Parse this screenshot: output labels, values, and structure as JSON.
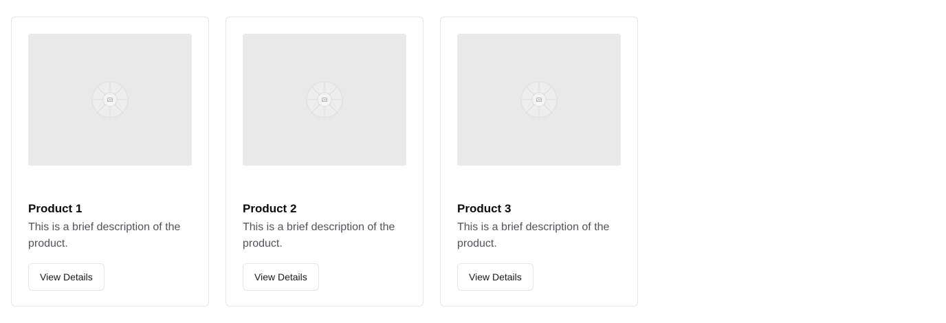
{
  "products": [
    {
      "title": "Product 1",
      "description": "This is a brief description of the product.",
      "button_label": "View Details",
      "image_icon": "image-placeholder-icon"
    },
    {
      "title": "Product 2",
      "description": "This is a brief description of the product.",
      "button_label": "View Details",
      "image_icon": "image-placeholder-icon"
    },
    {
      "title": "Product 3",
      "description": "This is a brief description of the product.",
      "button_label": "View Details",
      "image_icon": "image-placeholder-icon"
    }
  ],
  "colors": {
    "image_background": "#e9e9e9",
    "card_border": "#e4e4e7",
    "title_text": "#0a0a0a",
    "description_text": "#52525b"
  }
}
